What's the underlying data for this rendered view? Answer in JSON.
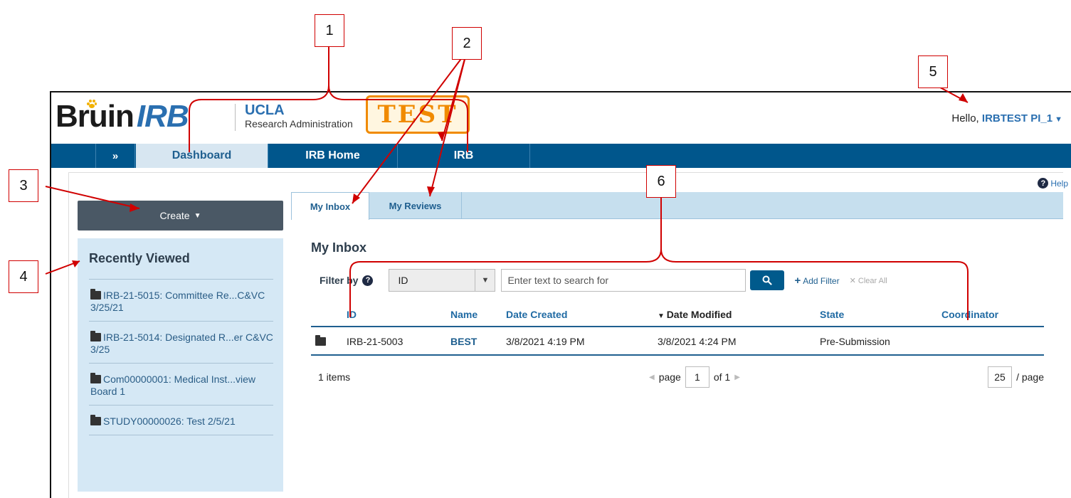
{
  "header": {
    "logo_main": "Bruin",
    "logo_accent": "IRB",
    "org_name": "UCLA",
    "org_sub": "Research Administration",
    "env_badge": "TEST",
    "greeting": "Hello,",
    "user_name": "IRBTEST PI_1"
  },
  "nav": {
    "expand_label": "»",
    "items": [
      {
        "label": "Dashboard",
        "active": true
      },
      {
        "label": "IRB Home",
        "active": false
      },
      {
        "label": "IRB",
        "active": false
      }
    ]
  },
  "help": {
    "label": "Help"
  },
  "sidebar": {
    "create_label": "Create",
    "recent_title": "Recently Viewed",
    "recent_items": [
      {
        "label": "IRB-21-5015: Committee Re...C&VC 3/25/21"
      },
      {
        "label": "IRB-21-5014: Designated R...er C&VC 3/25"
      },
      {
        "label": "Com00000001: Medical Inst...view Board 1"
      },
      {
        "label": "STUDY00000026: Test 2/5/21"
      }
    ]
  },
  "main": {
    "tabs": [
      {
        "label": "My Inbox",
        "active": true
      },
      {
        "label": "My Reviews",
        "active": false
      }
    ],
    "title": "My Inbox",
    "filter": {
      "label": "Filter by",
      "selected_field": "ID",
      "search_placeholder": "Enter text to search for",
      "add_filter": "Add Filter",
      "clear_all": "Clear All"
    },
    "columns": [
      "ID",
      "Name",
      "Date Created",
      "Date Modified",
      "State",
      "Coordinator"
    ],
    "rows": [
      {
        "id": "IRB-21-5003",
        "name": "BEST",
        "date_created": "3/8/2021 4:19 PM",
        "date_modified": "3/8/2021 4:24 PM",
        "state": "Pre-Submission",
        "coordinator": ""
      }
    ],
    "pager": {
      "items_count": "1 items",
      "page_label": "page",
      "current_page": "1",
      "of_label": "of 1",
      "per_page": "25",
      "per_page_label": "/ page"
    }
  },
  "callouts": [
    "1",
    "2",
    "3",
    "4",
    "5",
    "6"
  ],
  "colors": {
    "nav_bg": "#00568c",
    "nav_active_bg": "#d7e6f1",
    "sidebar_bg": "#d5e8f5",
    "tab_bar_bg": "#c6dfee",
    "create_bg": "#4a5865",
    "annotation_red": "#d00000",
    "test_badge": "#f08a00"
  }
}
